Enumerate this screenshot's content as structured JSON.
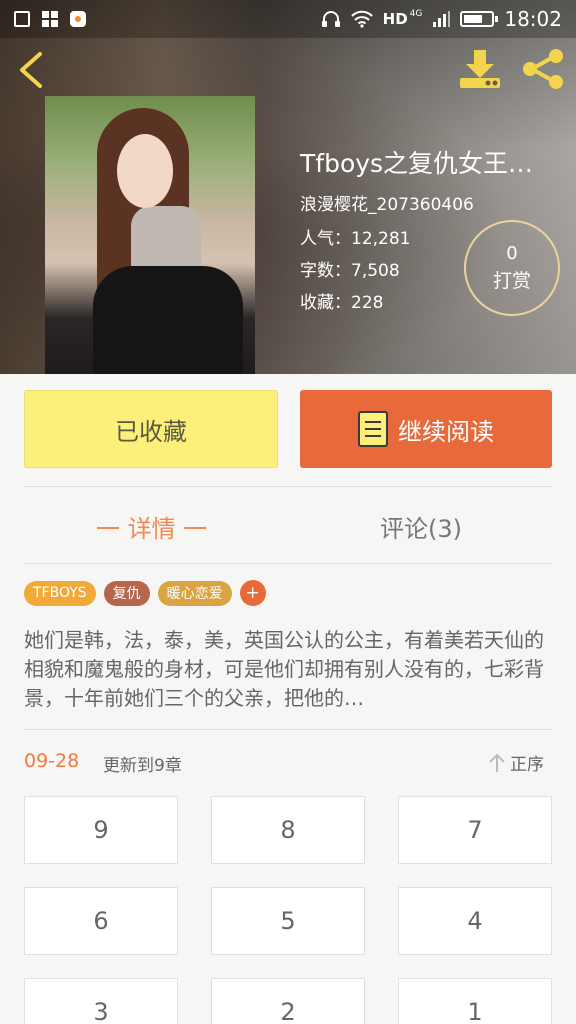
{
  "status_bar": {
    "network": "HD",
    "signal_type": "4G",
    "time": "18:02"
  },
  "book": {
    "title": "Tfboys之复仇女王…",
    "author": "浪漫樱花_207360406",
    "popularity": "人气：12,281",
    "words": "字数：7,508",
    "favorites": "收藏：228"
  },
  "tip": {
    "count": "0",
    "label": "打赏"
  },
  "actions": {
    "collected_label": "已收藏",
    "continue_label": "继续阅读"
  },
  "tabs": {
    "detail": "一 详情 一",
    "comments": "评论(3)"
  },
  "tags": [
    {
      "label": "TFBOYS",
      "color": "#f1a93a"
    },
    {
      "label": "复仇",
      "color": "#b5664c"
    },
    {
      "label": "暖心恋爱",
      "color": "#d9a441"
    }
  ],
  "tag_add": "+",
  "synopsis": "她们是韩，法，泰，美，英国公认的公主，有着美若天仙的相貌和魔鬼般的身材，可是他们却拥有别人没有的，七彩背景，十年前她们三个的父亲，把他的…",
  "updates": {
    "date": "09-28",
    "text": "更新到9章",
    "sort_label": "正序"
  },
  "chapters": [
    "9",
    "8",
    "7",
    "6",
    "5",
    "4",
    "3",
    "2",
    "1"
  ],
  "colors": {
    "accent": "#e8693a",
    "collected": "#fdf07a",
    "tab_active": "#ef8a54"
  }
}
